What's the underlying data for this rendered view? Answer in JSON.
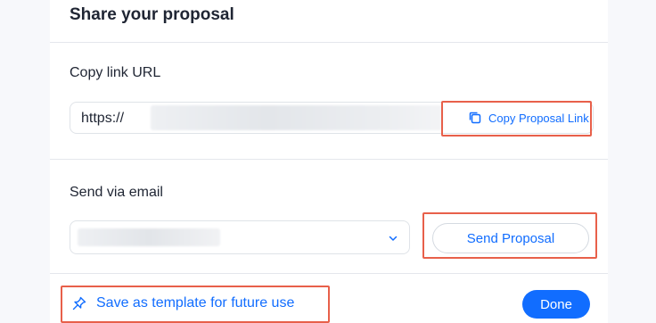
{
  "dialog": {
    "title": "Share your proposal",
    "copy_section": {
      "label": "Copy link URL",
      "url_prefix": "https://",
      "copy_link_label": "Copy Proposal Link",
      "copy_icon": "copy-icon"
    },
    "email_section": {
      "label": "Send via email",
      "select_icon": "chevron-down-icon",
      "send_button_label": "Send Proposal"
    },
    "footer": {
      "save_template_label": "Save as template for future use",
      "save_template_icon": "pin-icon",
      "done_label": "Done"
    }
  },
  "colors": {
    "accent": "#116dff",
    "highlight": "#e8604a",
    "text": "#1f2533"
  }
}
